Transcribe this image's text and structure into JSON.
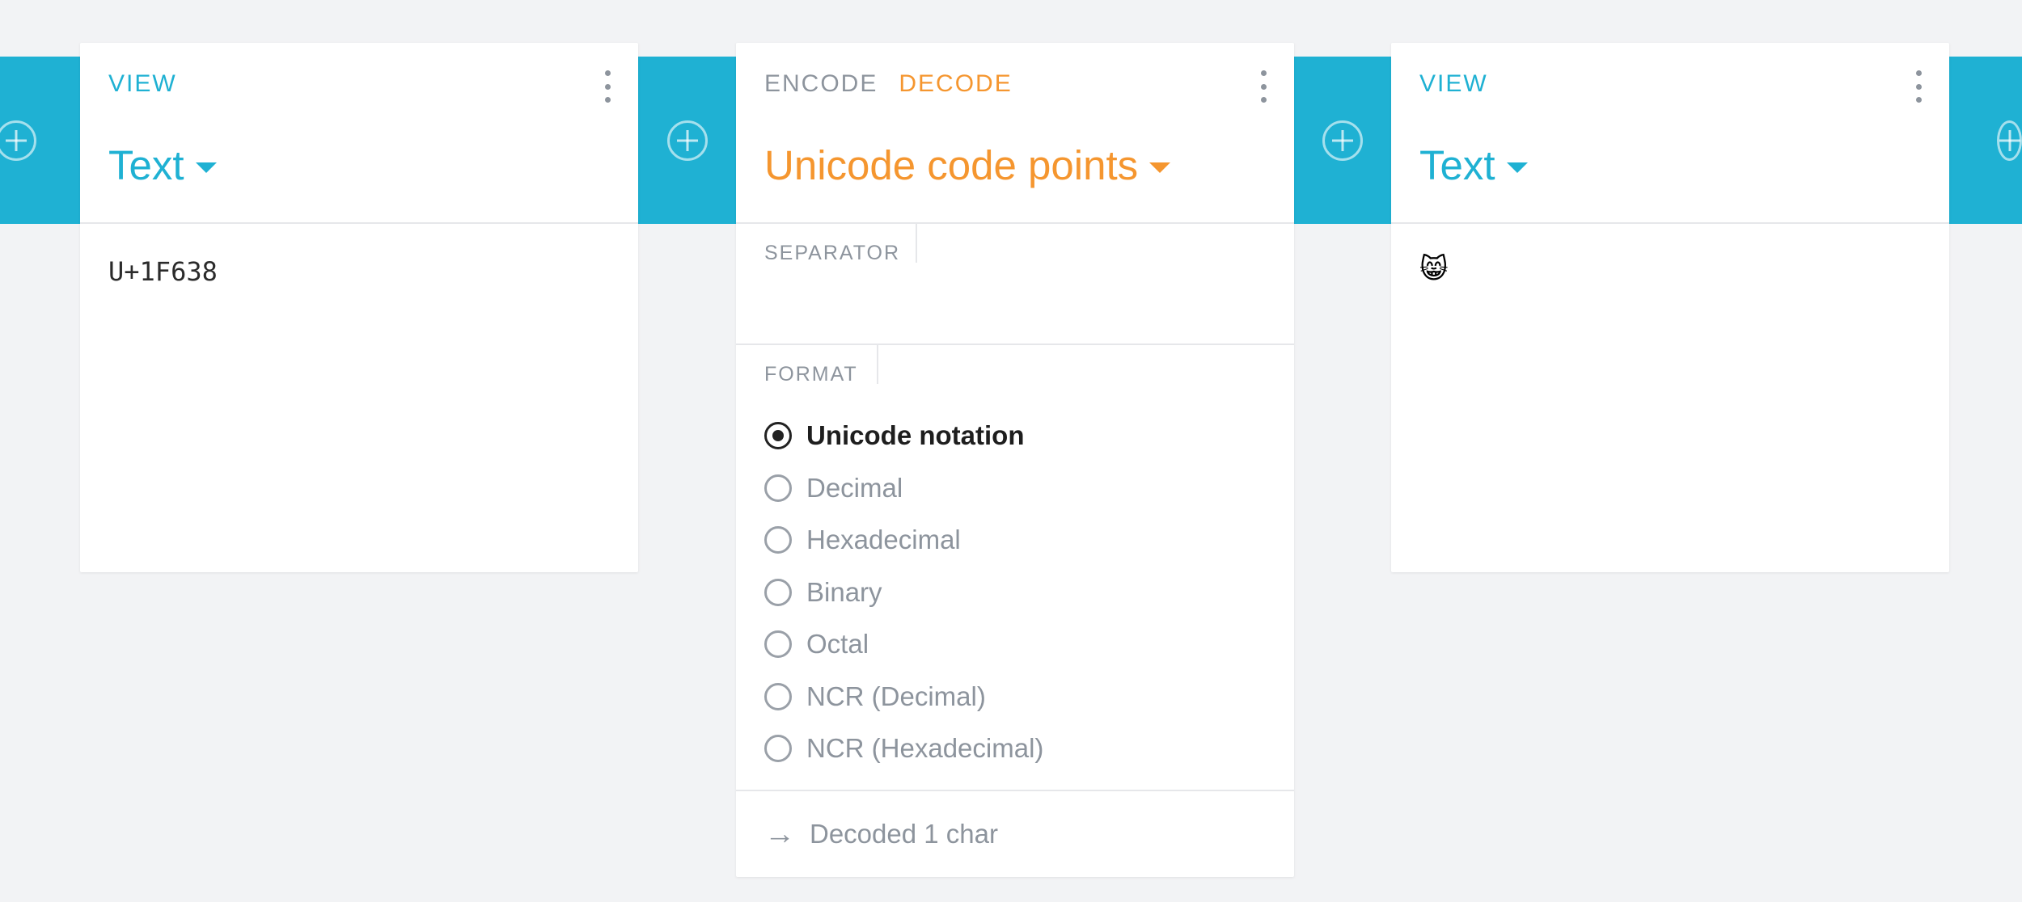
{
  "left_card": {
    "tab": "VIEW",
    "format": "Text",
    "content": "U+1F638"
  },
  "middle_card": {
    "tabs": [
      "ENCODE",
      "DECODE"
    ],
    "active_tab": "DECODE",
    "format": "Unicode code points",
    "separator": {
      "label": "SEPARATOR",
      "value": ""
    },
    "format_section": {
      "label": "FORMAT",
      "options": [
        "Unicode notation",
        "Decimal",
        "Hexadecimal",
        "Binary",
        "Octal",
        "NCR (Decimal)",
        "NCR (Hexadecimal)"
      ],
      "selected": "Unicode notation"
    },
    "status": "Decoded 1 char"
  },
  "right_card": {
    "tab": "VIEW",
    "format": "Text",
    "content": "😸"
  },
  "icons": {
    "add": "plus-circle-icon",
    "menu": "vertical-dots-icon",
    "caret": "caret-down-icon",
    "status": "arrow-right-icon"
  },
  "colors": {
    "accent_teal": "#1fb1d3",
    "accent_orange": "#f5962f",
    "muted": "#8d949d",
    "background": "#f2f3f5"
  }
}
